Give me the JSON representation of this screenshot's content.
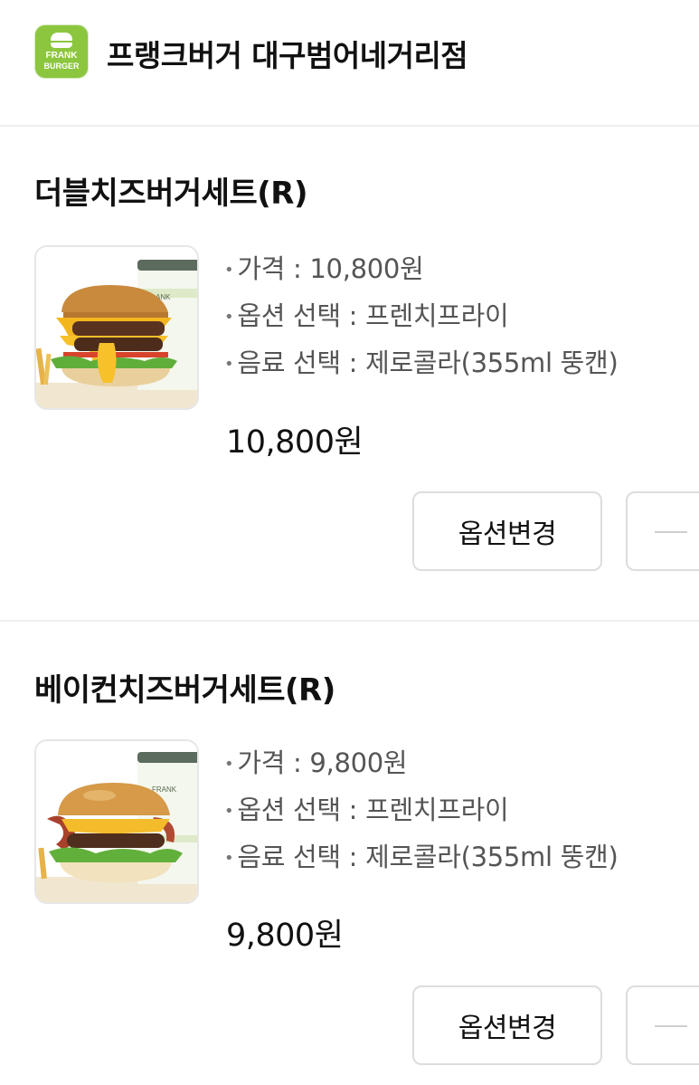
{
  "store": {
    "logo_line1": "FRANK",
    "logo_line2": "BURGER",
    "name": "프랭크버거 대구범어네거리점"
  },
  "items": [
    {
      "title": "더블치즈버거세트(R)",
      "image_icon": "double-cheeseburger-set-photo",
      "details": [
        "가격 : 10,800원",
        "옵션 선택 : 프렌치프라이",
        "음료 선택 : 제로콜라(355ml 뚱캔)"
      ],
      "total": "10,800원",
      "option_button": "옵션변경",
      "minus_icon": "minus-icon"
    },
    {
      "title": "베이컨치즈버거세트(R)",
      "image_icon": "bacon-cheeseburger-set-photo",
      "details": [
        "가격 : 9,800원",
        "옵션 선택 : 프렌치프라이",
        "음료 선택 : 제로콜라(355ml 뚱캔)"
      ],
      "total": "9,800원",
      "option_button": "옵션변경",
      "minus_icon": "minus-icon"
    }
  ],
  "colors": {
    "brand_green": "#8cc63f",
    "divider": "#efefef",
    "text_primary": "#111111",
    "text_secondary": "#555555",
    "button_border": "#dddddd"
  }
}
